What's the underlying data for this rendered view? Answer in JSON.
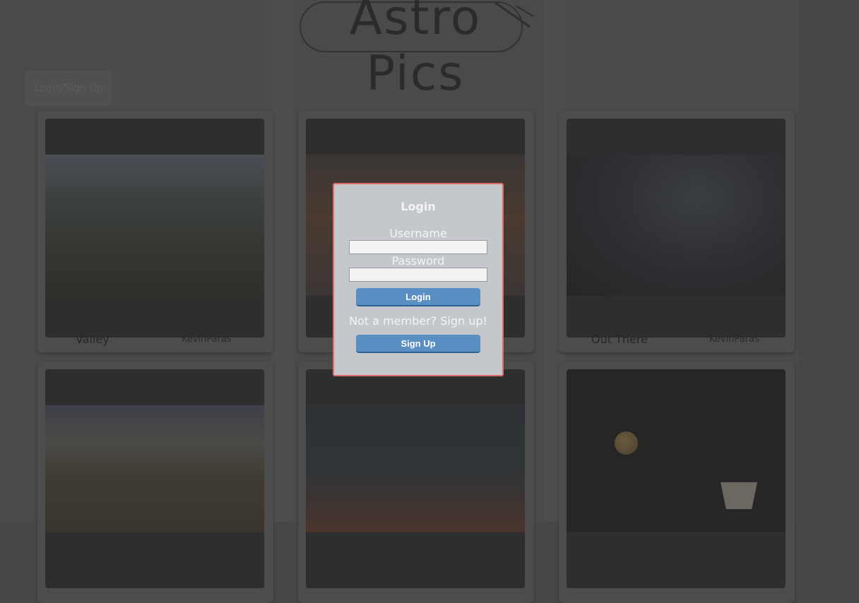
{
  "header": {
    "logo_text": "Astro Pics",
    "auth_button_label": "Login/Sign Up"
  },
  "gallery": {
    "cards": [
      {
        "title": "Valley",
        "author": "KevinParas"
      },
      {
        "title": "",
        "author": ""
      },
      {
        "title": "Out There",
        "author": "KevinParas"
      },
      {
        "title": "",
        "author": ""
      },
      {
        "title": "",
        "author": ""
      },
      {
        "title": "",
        "author": ""
      }
    ]
  },
  "modal": {
    "title": "Login",
    "username_label": "Username",
    "username_value": "",
    "password_label": "Password",
    "password_value": "",
    "login_button": "Login",
    "signup_prompt": "Not a member? Sign up!",
    "signup_button": "Sign Up",
    "accent_color": "#e06a6a",
    "button_color": "#5a8fc3"
  }
}
